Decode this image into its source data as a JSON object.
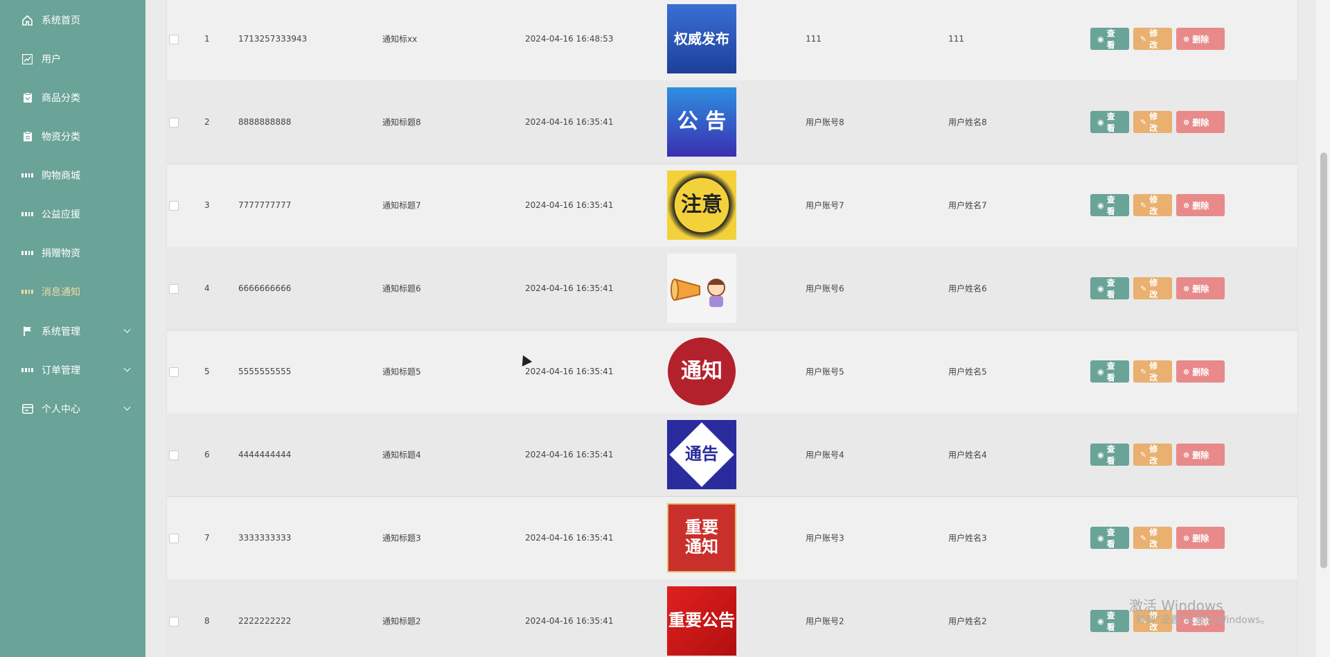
{
  "sidebar": {
    "items": [
      {
        "label": "系统首页",
        "icon": "home-icon"
      },
      {
        "label": "用户",
        "icon": "chart-icon"
      },
      {
        "label": "商品分类",
        "icon": "clipboard-icon"
      },
      {
        "label": "物资分类",
        "icon": "clipboard-icon"
      },
      {
        "label": "购物商城",
        "icon": "grid-icon"
      },
      {
        "label": "公益应援",
        "icon": "grid-icon"
      },
      {
        "label": "捐赠物资",
        "icon": "grid-icon"
      },
      {
        "label": "消息通知",
        "icon": "grid-icon",
        "active": true
      },
      {
        "label": "系统管理",
        "icon": "flag-icon",
        "expandable": true
      },
      {
        "label": "订单管理",
        "icon": "grid-icon",
        "expandable": true
      },
      {
        "label": "个人中心",
        "icon": "card-icon",
        "expandable": true
      }
    ]
  },
  "table": {
    "rows": [
      {
        "idx": "1",
        "no": "1713257333943",
        "title": "通知标xx",
        "time": "2024-04-16 16:48:53",
        "image_text": "权威发布",
        "account": "111",
        "name": "111"
      },
      {
        "idx": "2",
        "no": "8888888888",
        "title": "通知标题8",
        "time": "2024-04-16 16:35:41",
        "image_text": "公 告",
        "account": "用户账号8",
        "name": "用户姓名8"
      },
      {
        "idx": "3",
        "no": "7777777777",
        "title": "通知标题7",
        "time": "2024-04-16 16:35:41",
        "image_text": "注意",
        "account": "用户账号7",
        "name": "用户姓名7"
      },
      {
        "idx": "4",
        "no": "6666666666",
        "title": "通知标题6",
        "time": "2024-04-16 16:35:41",
        "image_text": "",
        "account": "用户账号6",
        "name": "用户姓名6"
      },
      {
        "idx": "5",
        "no": "5555555555",
        "title": "通知标题5",
        "time": "2024-04-16 16:35:41",
        "image_text": "通知",
        "account": "用户账号5",
        "name": "用户姓名5"
      },
      {
        "idx": "6",
        "no": "4444444444",
        "title": "通知标题4",
        "time": "2024-04-16 16:35:41",
        "image_text": "通告",
        "account": "用户账号4",
        "name": "用户姓名4"
      },
      {
        "idx": "7",
        "no": "3333333333",
        "title": "通知标题3",
        "time": "2024-04-16 16:35:41",
        "image_text": "重要通知",
        "account": "用户账号3",
        "name": "用户姓名3"
      },
      {
        "idx": "8",
        "no": "2222222222",
        "title": "通知标题2",
        "time": "2024-04-16 16:35:41",
        "image_text": "重要公告",
        "account": "用户账号2",
        "name": "用户姓名2"
      }
    ],
    "actions": {
      "view": "查看",
      "edit": "修改",
      "delete": "删除"
    }
  },
  "colors": {
    "sidebar_bg": "#6aa398",
    "view": "#6aa398",
    "edit": "#e9b06f",
    "delete": "#e88a8a",
    "active_nav": "#f1d9a6"
  },
  "watermark": {
    "line1": "激活 Windows",
    "line2": "转到“设置”以激活 Windows。"
  }
}
